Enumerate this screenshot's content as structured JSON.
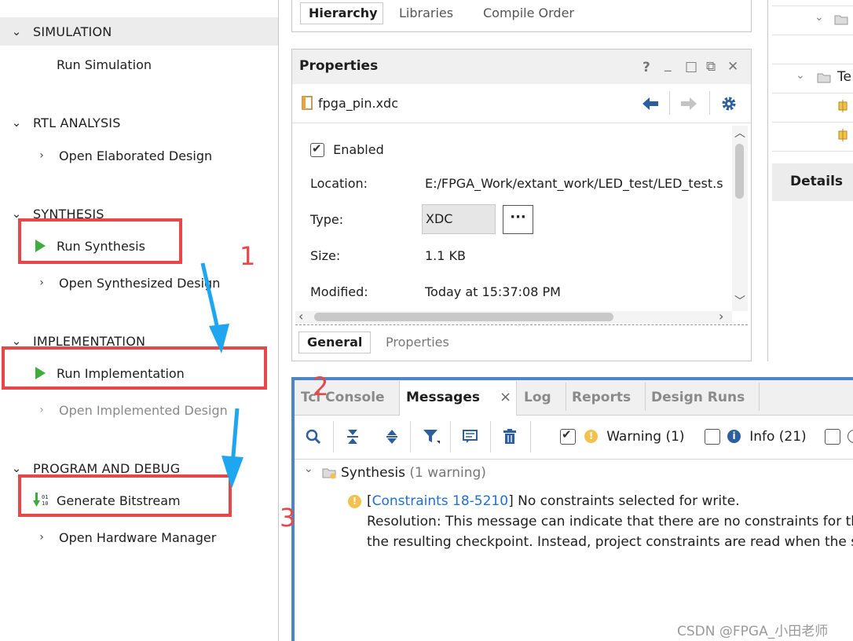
{
  "flow_navigator": {
    "sections": [
      {
        "title": "SIMULATION",
        "items": [
          {
            "label": "Run Simulation"
          }
        ]
      },
      {
        "title": "RTL ANALYSIS",
        "items": [
          {
            "label": "Open Elaborated Design"
          }
        ]
      },
      {
        "title": "SYNTHESIS",
        "items": [
          {
            "label": "Run Synthesis"
          },
          {
            "label": "Open Synthesized Design"
          }
        ]
      },
      {
        "title": "IMPLEMENTATION",
        "items": [
          {
            "label": "Run Implementation"
          },
          {
            "label": "Open Implemented Design"
          }
        ]
      },
      {
        "title": "PROGRAM AND DEBUG",
        "items": [
          {
            "label": "Generate Bitstream"
          },
          {
            "label": "Open Hardware Manager"
          }
        ]
      }
    ]
  },
  "annotations": {
    "step1": "1",
    "step2": "2",
    "step3": "3"
  },
  "sources_tabs": [
    "Hierarchy",
    "Libraries",
    "Compile Order"
  ],
  "properties": {
    "title": "Properties",
    "header_buttons": [
      "?",
      "_",
      "□",
      "⧉",
      "✕"
    ],
    "file_name": "fpga_pin.xdc",
    "enabled_label": "Enabled",
    "location_label": "Location:",
    "location_value": "E:/FPGA_Work/extant_work/LED_test/LED_test.s",
    "type_label": "Type:",
    "type_value": "XDC",
    "type_more": "···",
    "size_label": "Size:",
    "size_value": "1.1 KB",
    "modified_label": "Modified:",
    "modified_value": "Today at 15:37:08 PM",
    "bottom_tabs": [
      "General",
      "Properties"
    ]
  },
  "right_pane": {
    "details_label": "Details",
    "tree_label": "Te"
  },
  "messages": {
    "tabs": [
      "Tcl Console",
      "Messages",
      "Log",
      "Reports",
      "Design Runs"
    ],
    "close_glyph": "×",
    "filters": {
      "warning": "Warning (1)",
      "info": "Info (21)"
    },
    "group_label": "Synthesis",
    "group_count": "(1 warning)",
    "warning_link": "Constraints 18-5210",
    "warning_text": "No constraints selected for write.",
    "resolution_line1": "Resolution: This message can indicate that there are no constraints for the de",
    "resolution_line2": "the resulting checkpoint. Instead, project constraints are read when the synthe"
  },
  "watermark": "CSDN @FPGA_小田老师",
  "colors": {
    "annotation_red": "#e8474a",
    "annotation_blue": "#1ea7f0",
    "run_green": "#3cae3c",
    "link_blue": "#1f6fd6",
    "frame_blue": "#4a86c8"
  }
}
